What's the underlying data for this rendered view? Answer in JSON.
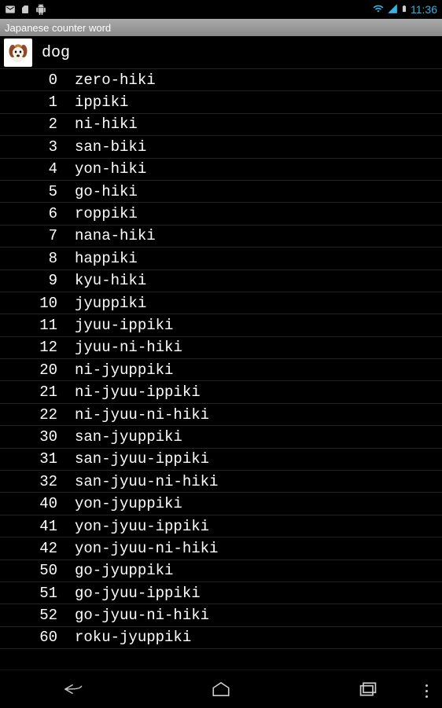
{
  "status": {
    "time": "11:36"
  },
  "titleBar": "Japanese counter word",
  "header": {
    "label": "dog"
  },
  "rows": [
    {
      "num": "0",
      "word": "zero-hiki"
    },
    {
      "num": "1",
      "word": "ippiki"
    },
    {
      "num": "2",
      "word": "ni-hiki"
    },
    {
      "num": "3",
      "word": "san-biki"
    },
    {
      "num": "4",
      "word": "yon-hiki"
    },
    {
      "num": "5",
      "word": "go-hiki"
    },
    {
      "num": "6",
      "word": "roppiki"
    },
    {
      "num": "7",
      "word": "nana-hiki"
    },
    {
      "num": "8",
      "word": "happiki"
    },
    {
      "num": "9",
      "word": "kyu-hiki"
    },
    {
      "num": "10",
      "word": "jyuppiki"
    },
    {
      "num": "11",
      "word": "jyuu-ippiki"
    },
    {
      "num": "12",
      "word": "jyuu-ni-hiki"
    },
    {
      "num": "20",
      "word": "ni-jyuppiki"
    },
    {
      "num": "21",
      "word": "ni-jyuu-ippiki"
    },
    {
      "num": "22",
      "word": "ni-jyuu-ni-hiki"
    },
    {
      "num": "30",
      "word": "san-jyuppiki"
    },
    {
      "num": "31",
      "word": "san-jyuu-ippiki"
    },
    {
      "num": "32",
      "word": "san-jyuu-ni-hiki"
    },
    {
      "num": "40",
      "word": "yon-jyuppiki"
    },
    {
      "num": "41",
      "word": "yon-jyuu-ippiki"
    },
    {
      "num": "42",
      "word": "yon-jyuu-ni-hiki"
    },
    {
      "num": "50",
      "word": "go-jyuppiki"
    },
    {
      "num": "51",
      "word": "go-jyuu-ippiki"
    },
    {
      "num": "52",
      "word": "go-jyuu-ni-hiki"
    },
    {
      "num": "60",
      "word": "roku-jyuppiki"
    }
  ]
}
